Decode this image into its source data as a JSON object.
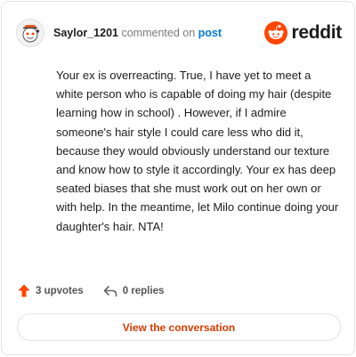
{
  "header": {
    "username": "Saylor_1201",
    "action_text": "commented on",
    "post_link": "post",
    "brand_name": "reddit"
  },
  "comment": {
    "text": "Your ex is overreacting. True, I have yet to meet a white person who is capable of doing my hair (despite learning how in school) . However, if I admire someone's hair style I could care less who did it, because they would obviously understand our texture and know how to style it accordingly. Your ex has deep seated biases that she must work out on her own or with help. In the meantime, let Milo continue doing your daughter's hair. NTA!"
  },
  "footer": {
    "upvotes": "3 upvotes",
    "replies": "0 replies"
  },
  "cta": {
    "label": "View the conversation"
  },
  "colors": {
    "brand_orange": "#ff4500",
    "link_blue": "#0079d3",
    "cta_text": "#d93a00"
  },
  "icons": [
    "avatar-snoo",
    "reddit-logo-icon",
    "upvote-arrow-icon",
    "reply-arrow-icon"
  ]
}
